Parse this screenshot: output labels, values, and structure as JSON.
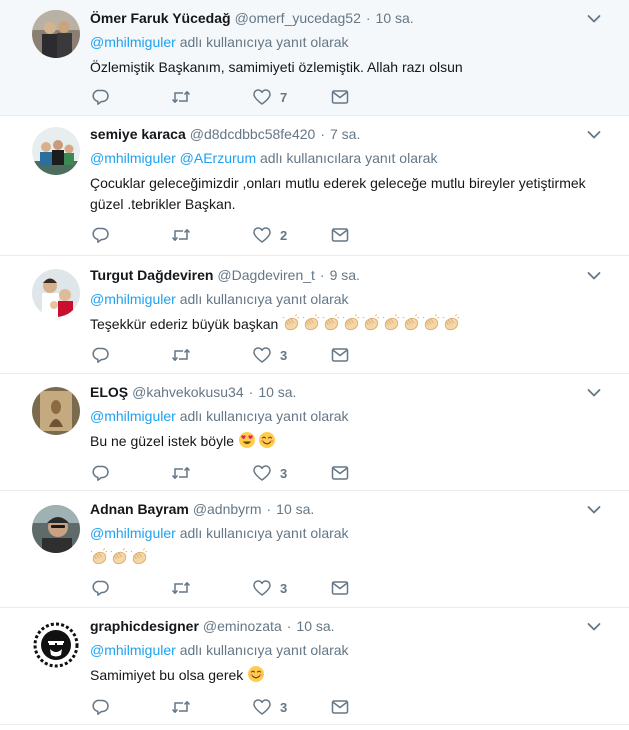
{
  "reply_prefix": "",
  "tweets": [
    {
      "name": "Ömer Faruk Yücedağ",
      "handle": "@omerf_yucedag52",
      "time": "10 sa.",
      "mentions": "@mhilmiguler",
      "reply_suffix": "adlı kullanıcıya yanıt olarak",
      "text": "Özlemiştik Başkanım, samimiyeti özlemiştik. Allah razı olsun",
      "likes": "7",
      "emoji": []
    },
    {
      "name": "semiye karaca",
      "handle": "@d8dcdbbc58fe420",
      "time": "7 sa.",
      "mentions": "@mhilmiguler @AErzurum",
      "reply_suffix": "adlı kullanıcılara yanıt olarak",
      "text": "Çocuklar geleceğimizdir ,onları mutlu ederek geleceğe mutlu bireyler yetiştirmek güzel .tebrikler Başkan.",
      "likes": "2",
      "emoji": []
    },
    {
      "name": "Turgut Dağdeviren",
      "handle": "@Dagdeviren_t",
      "time": "9 sa.",
      "mentions": "@mhilmiguler",
      "reply_suffix": "adlı kullanıcıya yanıt olarak",
      "text": "Teşekkür ederiz büyük başkan ",
      "likes": "3",
      "emoji": [
        "clap",
        "clap",
        "clap",
        "clap",
        "clap",
        "clap",
        "clap",
        "clap",
        "clap"
      ]
    },
    {
      "name": "ELOŞ",
      "handle": "@kahvekokusu34",
      "time": "10 sa.",
      "mentions": "@mhilmiguler",
      "reply_suffix": "adlı kullanıcıya yanıt olarak",
      "text": "Bu ne güzel istek böyle ",
      "likes": "3",
      "emoji": [
        "heart-eyes",
        "smile-blush"
      ]
    },
    {
      "name": "Adnan Bayram",
      "handle": "@adnbyrm",
      "time": "10 sa.",
      "mentions": "@mhilmiguler",
      "reply_suffix": "adlı kullanıcıya yanıt olarak",
      "text": "",
      "likes": "3",
      "emoji": [
        "clap",
        "clap",
        "clap"
      ]
    },
    {
      "name": "graphicdesigner",
      "handle": "@eminozata",
      "time": "10 sa.",
      "mentions": "@mhilmiguler",
      "reply_suffix": "adlı kullanıcıya yanıt olarak",
      "text": "Samimiyet bu olsa gerek ",
      "likes": "3",
      "emoji": [
        "smile-blush"
      ]
    }
  ],
  "colors": {
    "link": "#1da1f2",
    "muted": "#657786",
    "text": "#14171a",
    "highlight_bg": "#f5f8fa",
    "divider": "#e6ecf0"
  }
}
